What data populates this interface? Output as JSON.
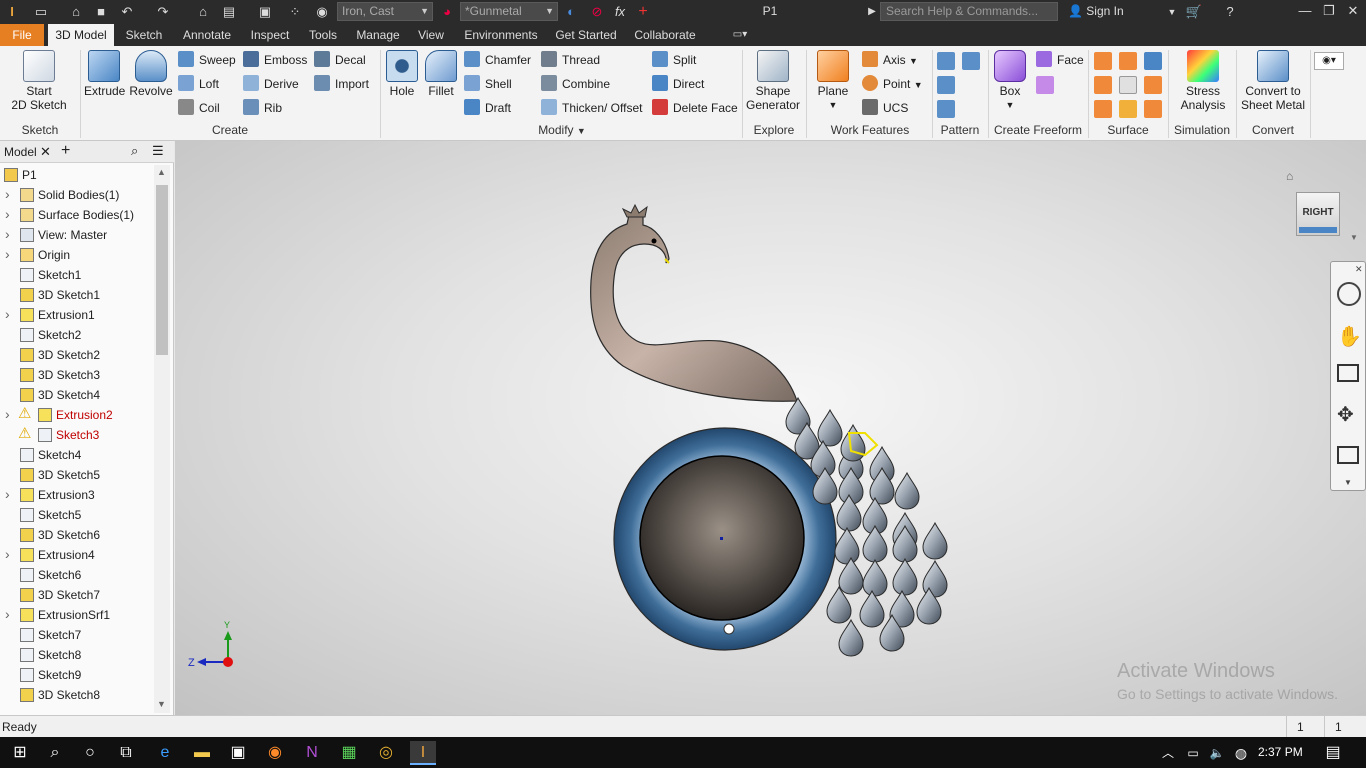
{
  "titlebar": {
    "material": "Iron, Cast",
    "appearance": "*Gunmetal",
    "document": "P1",
    "search_placeholder": "Search Help & Commands...",
    "sign_in": "Sign In"
  },
  "tabs": [
    "File",
    "3D Model",
    "Sketch",
    "Annotate",
    "Inspect",
    "Tools",
    "Manage",
    "View",
    "Environments",
    "Get Started",
    "Collaborate"
  ],
  "ribbon": {
    "sketch": {
      "start_line1": "Start",
      "start_line2": "2D Sketch",
      "panel": "Sketch"
    },
    "create": {
      "extrude": "Extrude",
      "revolve": "Revolve",
      "sweep": "Sweep",
      "loft": "Loft",
      "coil": "Coil",
      "emboss": "Emboss",
      "derive": "Derive",
      "rib": "Rib",
      "decal": "Decal",
      "import": "Import",
      "panel": "Create"
    },
    "modify": {
      "hole": "Hole",
      "fillet": "Fillet",
      "chamfer": "Chamfer",
      "shell": "Shell",
      "draft": "Draft",
      "thread": "Thread",
      "combine": "Combine",
      "thicken": "Thicken/ Offset",
      "split": "Split",
      "direct": "Direct",
      "delete_face": "Delete Face",
      "panel": "Modify"
    },
    "explore": {
      "line1": "Shape",
      "line2": "Generator",
      "panel": "Explore"
    },
    "work": {
      "plane": "Plane",
      "axis": "Axis",
      "point": "Point",
      "ucs": "UCS",
      "panel": "Work Features"
    },
    "pattern": {
      "panel": "Pattern"
    },
    "freeform": {
      "box": "Box",
      "face": "Face",
      "panel": "Create Freeform"
    },
    "surface": {
      "panel": "Surface"
    },
    "simulation": {
      "line1": "Stress",
      "line2": "Analysis",
      "panel": "Simulation"
    },
    "convert": {
      "line1": "Convert to",
      "line2": "Sheet Metal",
      "panel": "Convert"
    }
  },
  "browser": {
    "tab": "Model",
    "items": [
      {
        "label": "P1",
        "icon": "part-icon",
        "expand": false,
        "warn": false
      },
      {
        "label": "Solid Bodies(1)",
        "icon": "solid-bodies-icon",
        "expand": true,
        "warn": false
      },
      {
        "label": "Surface Bodies(1)",
        "icon": "surface-bodies-icon",
        "expand": true,
        "warn": false
      },
      {
        "label": "View: Master",
        "icon": "view-icon",
        "expand": true,
        "warn": false
      },
      {
        "label": "Origin",
        "icon": "folder-icon",
        "expand": true,
        "warn": false
      },
      {
        "label": "Sketch1",
        "icon": "sketch-icon",
        "expand": false,
        "warn": false
      },
      {
        "label": "3D Sketch1",
        "icon": "sketch3d-icon",
        "expand": false,
        "warn": false
      },
      {
        "label": "Extrusion1",
        "icon": "extrusion-icon",
        "expand": true,
        "warn": false
      },
      {
        "label": "Sketch2",
        "icon": "sketch-icon",
        "expand": false,
        "warn": false
      },
      {
        "label": "3D Sketch2",
        "icon": "sketch3d-icon",
        "expand": false,
        "warn": false
      },
      {
        "label": "3D Sketch3",
        "icon": "sketch3d-icon",
        "expand": false,
        "warn": false
      },
      {
        "label": "3D Sketch4",
        "icon": "sketch3d-icon",
        "expand": false,
        "warn": false
      },
      {
        "label": "Extrusion2",
        "icon": "extrusion-icon",
        "expand": true,
        "warn": true
      },
      {
        "label": "Sketch3",
        "icon": "sketch-icon",
        "expand": false,
        "warn": true
      },
      {
        "label": "Sketch4",
        "icon": "sketch-icon",
        "expand": false,
        "warn": false
      },
      {
        "label": "3D Sketch5",
        "icon": "sketch3d-icon",
        "expand": false,
        "warn": false
      },
      {
        "label": "Extrusion3",
        "icon": "extrusion-icon",
        "expand": true,
        "warn": false
      },
      {
        "label": "Sketch5",
        "icon": "sketch-icon",
        "expand": false,
        "warn": false
      },
      {
        "label": "3D Sketch6",
        "icon": "sketch3d-icon",
        "expand": false,
        "warn": false
      },
      {
        "label": "Extrusion4",
        "icon": "extrusion-icon",
        "expand": true,
        "warn": false
      },
      {
        "label": "Sketch6",
        "icon": "sketch-icon",
        "expand": false,
        "warn": false
      },
      {
        "label": "3D Sketch7",
        "icon": "sketch3d-icon",
        "expand": false,
        "warn": false
      },
      {
        "label": "ExtrusionSrf1",
        "icon": "extrusion-surface-icon",
        "expand": true,
        "warn": false
      },
      {
        "label": "Sketch7",
        "icon": "sketch-icon",
        "expand": false,
        "warn": false
      },
      {
        "label": "Sketch8",
        "icon": "sketch-icon",
        "expand": false,
        "warn": false
      },
      {
        "label": "Sketch9",
        "icon": "sketch-icon",
        "expand": false,
        "warn": false
      },
      {
        "label": "3D Sketch8",
        "icon": "sketch3d-icon",
        "expand": false,
        "warn": false
      }
    ]
  },
  "viewcube": {
    "face": "RIGHT"
  },
  "axis_labels": {
    "y": "Y",
    "z": "Z"
  },
  "watermark": {
    "line1": "Activate Windows",
    "line2": "Go to Settings to activate Windows."
  },
  "status": {
    "text": "Ready",
    "count1": "1",
    "count2": "1"
  },
  "taskbar": {
    "time": "2:37 PM"
  },
  "colors": {
    "file_tab": "#e67e22",
    "title_bg": "#2b2b2b",
    "warn": "#c00000",
    "ring": "#3f6e99"
  }
}
